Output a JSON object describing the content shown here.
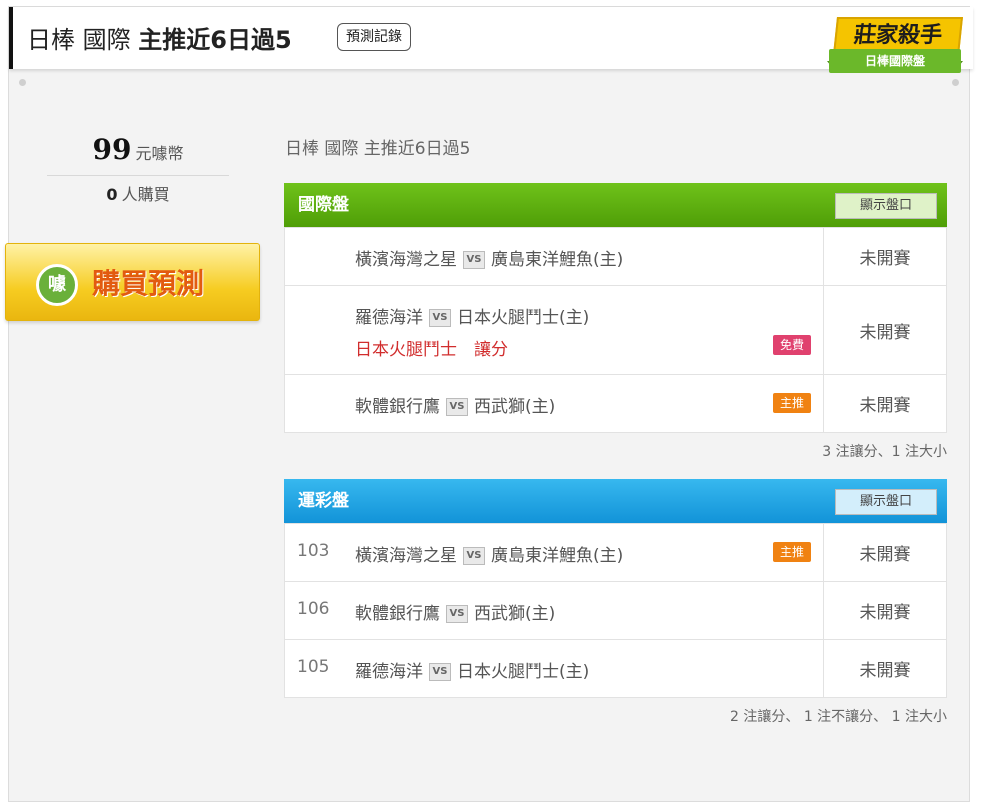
{
  "header": {
    "title_prefix": "日棒 國際",
    "title_bold": "主推近6日過5",
    "record_button": "預測記錄",
    "badge_title": "莊家殺手",
    "badge_subtitle": "日棒國際盤"
  },
  "sidebar": {
    "price_value": "99",
    "price_unit": "元噱幣",
    "buyers_value": "0",
    "buyers_unit": "人購買",
    "buy_icon": "噱",
    "buy_label": "購買預測"
  },
  "breadcrumb": "日棒 國際 主推近6日過5",
  "panels": {
    "international": {
      "title": "國際盤",
      "show_button": "顯示盤口",
      "games": [
        {
          "away": "橫濱海灣之星",
          "home": "廣島東洋鯉魚(主)",
          "status": "未開賽",
          "pick": "",
          "tag": ""
        },
        {
          "away": "羅德海洋",
          "home": "日本火腿鬥士(主)",
          "status": "未開賽",
          "pick": "日本火腿鬥士　讓分",
          "tag": "免費"
        },
        {
          "away": "軟體銀行鷹",
          "home": "西武獅(主)",
          "status": "未開賽",
          "pick": "",
          "tag": "主推"
        }
      ],
      "summary": "3 注讓分、1 注大小"
    },
    "sports_lottery": {
      "title": "運彩盤",
      "show_button": "顯示盤口",
      "games": [
        {
          "number": "103",
          "away": "橫濱海灣之星",
          "home": "廣島東洋鯉魚(主)",
          "status": "未開賽",
          "tag": "主推"
        },
        {
          "number": "106",
          "away": "軟體銀行鷹",
          "home": "西武獅(主)",
          "status": "未開賽",
          "tag": ""
        },
        {
          "number": "105",
          "away": "羅德海洋",
          "home": "日本火腿鬥士(主)",
          "status": "未開賽",
          "tag": ""
        }
      ],
      "summary": "2 注讓分、 1 注不讓分、 1 注大小"
    }
  },
  "vs_label": "VS",
  "colors": {
    "international_head": "#5aad0e",
    "sports_lottery_head": "#1fa6e4",
    "pick_text": "#d12d2d",
    "tag_free": "#e0416e",
    "tag_main": "#f08212"
  }
}
